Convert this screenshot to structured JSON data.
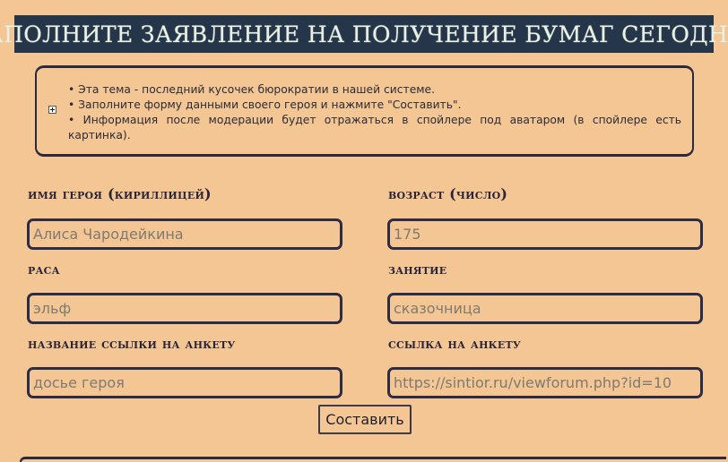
{
  "header": {
    "title": "ЗАПОЛНИТЕ ЗАЯВЛЕНИЕ НА ПОЛУЧЕНИЕ БУМАГ СЕГОДНЯ!"
  },
  "info": {
    "items": [
      "• Эта тема - последний кусочек бюрократии в нашей системе.",
      "• Заполните форму данными своего героя и нажмите \"Составить\".",
      "• Информация после модерации будет отражаться в спойлере под аватаром (в спойлере есть картинка)."
    ]
  },
  "form": {
    "hero_name": {
      "label": "имя героя (кириллицей)",
      "placeholder": "Алиса Чародейкина"
    },
    "age": {
      "label": "возраст (число)",
      "placeholder": "175"
    },
    "race": {
      "label": "раса",
      "placeholder": "эльф"
    },
    "occupation": {
      "label": "занятие",
      "placeholder": "сказочница"
    },
    "link_title": {
      "label": "название ссылки на анкету",
      "placeholder": "досье героя"
    },
    "link_url": {
      "label": "ссылка на анкету",
      "placeholder": "https://sintior.ru/viewforum.php?id=10"
    },
    "submit_label": "Составить"
  },
  "colors": {
    "background": "#f4c694",
    "banner": "#25354a",
    "border": "#2c2c44"
  }
}
